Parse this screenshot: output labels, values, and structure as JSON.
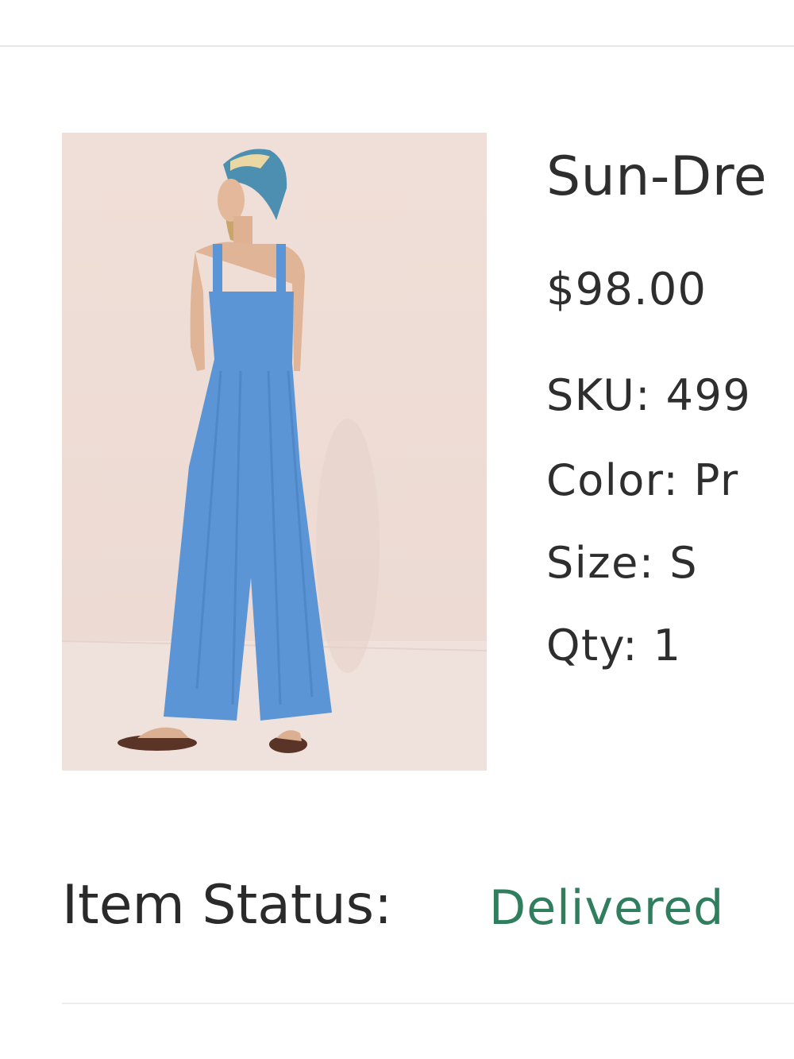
{
  "product": {
    "title": "Sun-Dre",
    "price": "$98.00",
    "attributes": [
      {
        "label": "SKU:",
        "value": "499"
      },
      {
        "label": "Color:",
        "value": "Pr"
      },
      {
        "label": "Size:",
        "value": "S"
      },
      {
        "label": "Qty:",
        "value": "1"
      }
    ],
    "image": {
      "icon": "product-photo-icon"
    }
  },
  "status": {
    "label": "Item Status:",
    "value": "Delivered",
    "color": "#2f7f5e"
  },
  "colors": {
    "text": "#2e2e2e",
    "divider": "#e6e6e6",
    "photo_background": "#ecdad3",
    "garment": "#5b95d6"
  }
}
